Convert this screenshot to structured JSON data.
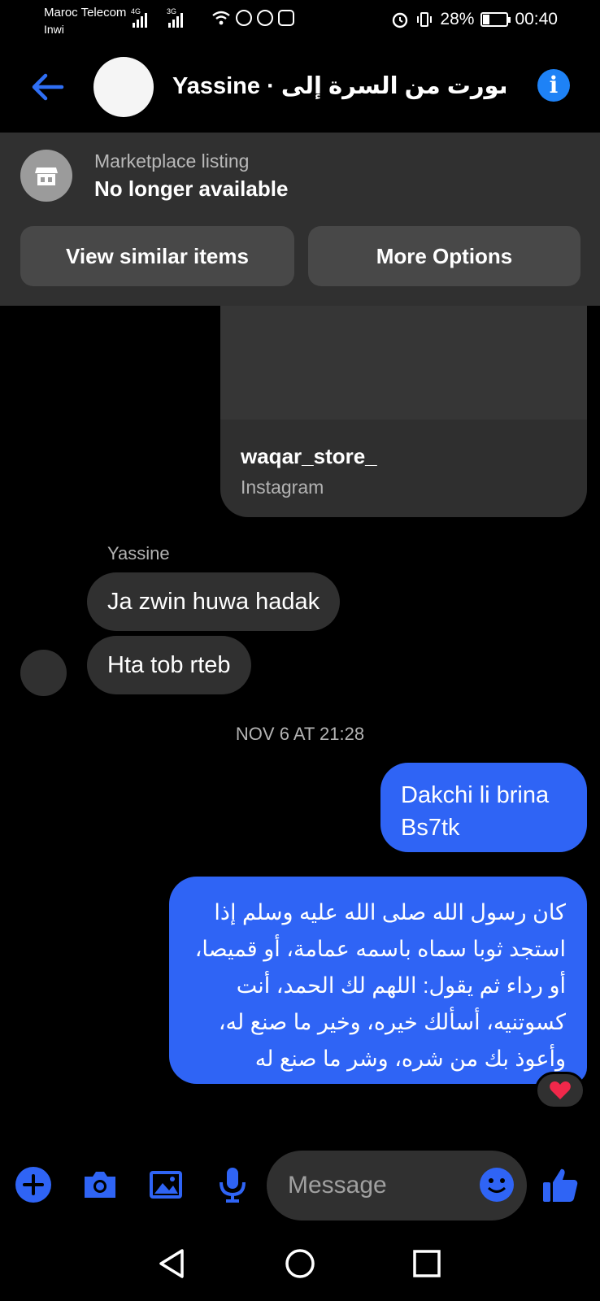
{
  "status_bar": {
    "carrier_1": "Maroc Telecom",
    "carrier_2": "Inwi",
    "net_1": "4G",
    "net_2": "3G",
    "battery": "28%",
    "time": "00:40"
  },
  "header": {
    "title": "Yassine · شورت من السرة إلى ...",
    "back_icon": "back-arrow-icon",
    "info_icon": "info-icon",
    "info_glyph": "i"
  },
  "marketplace": {
    "subtitle": "Marketplace listing",
    "title": "No longer available",
    "view_similar": "View similar items",
    "more_options": "More Options"
  },
  "shared_card": {
    "title": "waqar_store_",
    "source": "Instagram"
  },
  "messages": {
    "sender_name": "Yassine",
    "incoming": [
      "Ja zwin huwa hadak",
      "Hta tob rteb"
    ],
    "timestamp": "NOV 6 AT 21:28",
    "outgoing_1": "Dakchi li brina Bs7tk",
    "outgoing_2": "كان رسول الله صلى الله عليه وسلم إذا استجد ثوبا سماه باسمه عمامة، أو قميصا، أو رداء ثم يقول: اللهم لك الحمد، أنت كسوتنيه، أسألك خيره، وخير ما صنع له، وأعوذ بك من شره، وشر ما صنع له",
    "reaction": "heart"
  },
  "composer": {
    "placeholder": "Message",
    "icons": [
      "plus-icon",
      "camera-icon",
      "gallery-icon",
      "microphone-icon",
      "emoji-icon",
      "thumbs-up-icon"
    ]
  },
  "colors": {
    "accent": "#2f64f5",
    "header_accent": "#1e82f6",
    "bubble_incoming": "#303030",
    "background": "#000000"
  }
}
